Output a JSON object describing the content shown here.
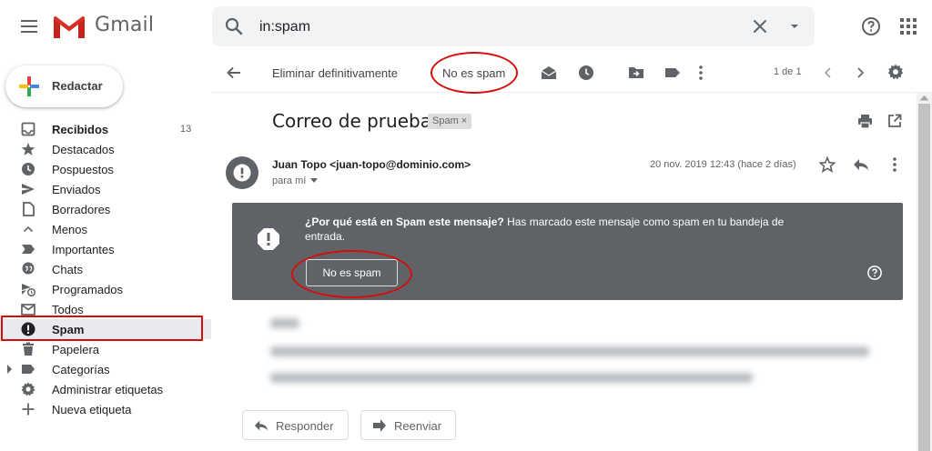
{
  "app": {
    "name": "Gmail"
  },
  "search": {
    "value": "in:spam"
  },
  "compose": {
    "label": "Redactar"
  },
  "sidebar": {
    "items": [
      {
        "label": "Recibidos",
        "count": "13",
        "icon": "inbox-icon"
      },
      {
        "label": "Destacados",
        "icon": "star-icon"
      },
      {
        "label": "Pospuestos",
        "icon": "clock-icon"
      },
      {
        "label": "Enviados",
        "icon": "send-icon"
      },
      {
        "label": "Borradores",
        "icon": "draft-icon"
      },
      {
        "label": "Menos",
        "icon": "chevron-up-icon"
      },
      {
        "label": "Importantes",
        "icon": "label-important-icon"
      },
      {
        "label": "Chats",
        "icon": "chat-icon"
      },
      {
        "label": "Programados",
        "icon": "schedule-send-icon"
      },
      {
        "label": "Todos",
        "icon": "mail-icon"
      },
      {
        "label": "Spam",
        "icon": "report-icon"
      },
      {
        "label": "Papelera",
        "icon": "trash-icon"
      },
      {
        "label": "Categorías",
        "icon": "label-icon"
      },
      {
        "label": "Administrar etiquetas",
        "icon": "gear-icon"
      },
      {
        "label": "Nueva etiqueta",
        "icon": "plus-icon"
      }
    ]
  },
  "toolbar": {
    "delete_forever": "Eliminar definitivamente",
    "not_spam": "No es spam",
    "paging": "1 de 1"
  },
  "message": {
    "subject": "Correo de prueba",
    "chip": "Spam",
    "chip_close": "×",
    "sender": "Juan Topo <juan-topo@dominio.com>",
    "to": "para mí",
    "date": "20 nov. 2019 12:43 (hace 2 días)"
  },
  "banner": {
    "question": "¿Por qué está en Spam este mensaje?",
    "explanation": " Has marcado este mensaje como spam en tu bandeja de entrada.",
    "button": "No es spam"
  },
  "actions": {
    "reply": "Responder",
    "forward": "Reenviar"
  },
  "colors": {
    "spam_banner": "#5f6368",
    "highlight": "#d40d0d",
    "active_nav": "#e8eaed"
  }
}
